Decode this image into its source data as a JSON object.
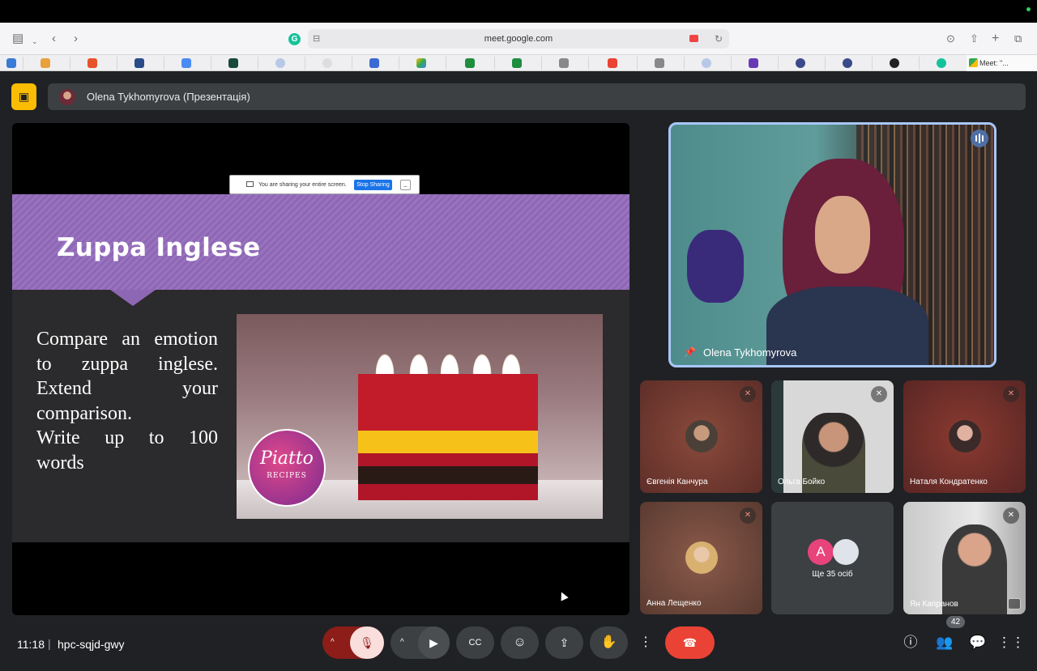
{
  "browser": {
    "url": "meet.google.com",
    "active_tab_label": "Meet: \"..."
  },
  "presentation": {
    "presenter_label": "Olena Tykhomyrova (Презентація)"
  },
  "share_notice": {
    "text": "You are sharing your entire screen.",
    "stop_label": "Stop Sharing",
    "hide_label": "_"
  },
  "slide": {
    "title": "Zuppa Inglese",
    "body_lines": [
      "Compare an emotion",
      "to zuppa inglese.",
      "Extend your",
      "comparison.",
      "Write up to 100",
      "words"
    ],
    "logo_name": "Piatto",
    "logo_sub": "RECIPES"
  },
  "speaker": {
    "name": "Olena Tykhomyrova"
  },
  "participants": [
    {
      "name": "Євгенія Канчура",
      "muted": true
    },
    {
      "name": "Ольга Бойко",
      "muted": true
    },
    {
      "name": "Наталя Кондратенко",
      "muted": true
    },
    {
      "name": "Анна Лещенко",
      "muted": true
    },
    {
      "name": "Ян Капранов",
      "muted": true
    }
  ],
  "others": {
    "initial": "A",
    "label": "Ще 35 осіб"
  },
  "bottombar": {
    "time": "11:18",
    "separator": "|",
    "meeting_code": "hpc-sqjd-gwy",
    "participant_count": "42"
  },
  "colors": {
    "meet_bg": "#202124",
    "presenting_accent": "#fbbc04",
    "end_call": "#ea4335",
    "slide_band": "#8e67b4",
    "speaker_border": "#a8c7fa"
  }
}
